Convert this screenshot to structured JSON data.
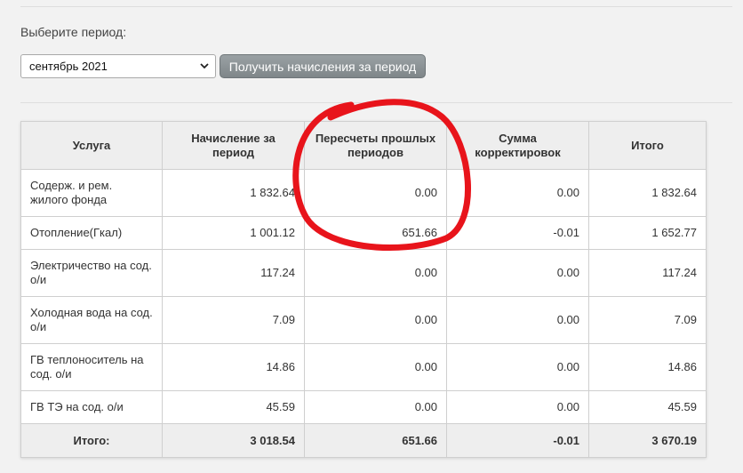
{
  "period": {
    "label": "Выберите период:",
    "selected": "сентябрь 2021",
    "button_label": "Получить начисления за период"
  },
  "table": {
    "headers": [
      "Услуга",
      "Начисление за период",
      "Пересчеты прошлых периодов",
      "Сумма корректировок",
      "Итого"
    ],
    "rows": [
      [
        "Содерж. и рем. жилого фонда",
        "1 832.64",
        "0.00",
        "0.00",
        "1 832.64"
      ],
      [
        "Отопление(Гкал)",
        "1 001.12",
        "651.66",
        "-0.01",
        "1 652.77"
      ],
      [
        "Электричество на сод. о/и",
        "117.24",
        "0.00",
        "0.00",
        "117.24"
      ],
      [
        "Холодная вода на сод. о/и",
        "7.09",
        "0.00",
        "0.00",
        "7.09"
      ],
      [
        "ГВ теплоноситель на сод. о/и",
        "14.86",
        "0.00",
        "0.00",
        "14.86"
      ],
      [
        "ГВ ТЭ на сод. о/и",
        "45.59",
        "0.00",
        "0.00",
        "45.59"
      ]
    ],
    "total": [
      "Итого:",
      "3 018.54",
      "651.66",
      "-0.01",
      "3 670.19"
    ]
  },
  "colors": {
    "annotation": "#e8141b",
    "button": "#868d90",
    "header_bg": "#eeeeee"
  }
}
